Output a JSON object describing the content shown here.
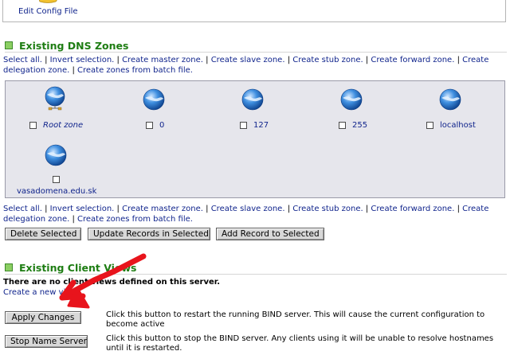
{
  "top": {
    "edit_config_label": "Edit Config File"
  },
  "dns_section": {
    "title": "Existing DNS Zones"
  },
  "zone_links": {
    "select_all": "Select all.",
    "invert": "Invert selection.",
    "create_master": "Create master zone.",
    "create_slave": "Create slave zone.",
    "create_stub": "Create stub zone.",
    "create_forward": "Create forward zone.",
    "create_delegation": "Create delegation zone.",
    "create_batch": "Create zones from batch file.",
    "separator": " | "
  },
  "zones": [
    {
      "name": "Root zone",
      "icon": "root-globe-icon",
      "checked": false
    },
    {
      "name": "0",
      "icon": "globe-icon",
      "checked": false
    },
    {
      "name": "127",
      "icon": "globe-icon",
      "checked": false
    },
    {
      "name": "255",
      "icon": "globe-icon",
      "checked": false
    },
    {
      "name": "localhost",
      "icon": "globe-icon",
      "checked": false
    },
    {
      "name": "vasadomena.edu.sk",
      "icon": "globe-icon",
      "checked": false
    }
  ],
  "zone_buttons": {
    "delete": "Delete Selected",
    "update": "Update Records in Selected",
    "add": "Add Record to Selected"
  },
  "views_section": {
    "title": "Existing Client Views",
    "empty_msg": "There are no client views defined on this server.",
    "create_link": "Create a new view."
  },
  "actions": {
    "apply_button": "Apply Changes",
    "apply_desc": "Click this button to restart the running BIND server. This will cause the current configuration to become active",
    "stop_button": "Stop Name Server",
    "stop_desc": "Click this button to stop the BIND server. Any clients using it will be unable to resolve hostnames until it is restarted."
  },
  "colors": {
    "section_title": "#1e7d13",
    "link": "#10248c",
    "annotation_arrow": "#e8141c",
    "panel_bg": "#e6e6ec"
  }
}
